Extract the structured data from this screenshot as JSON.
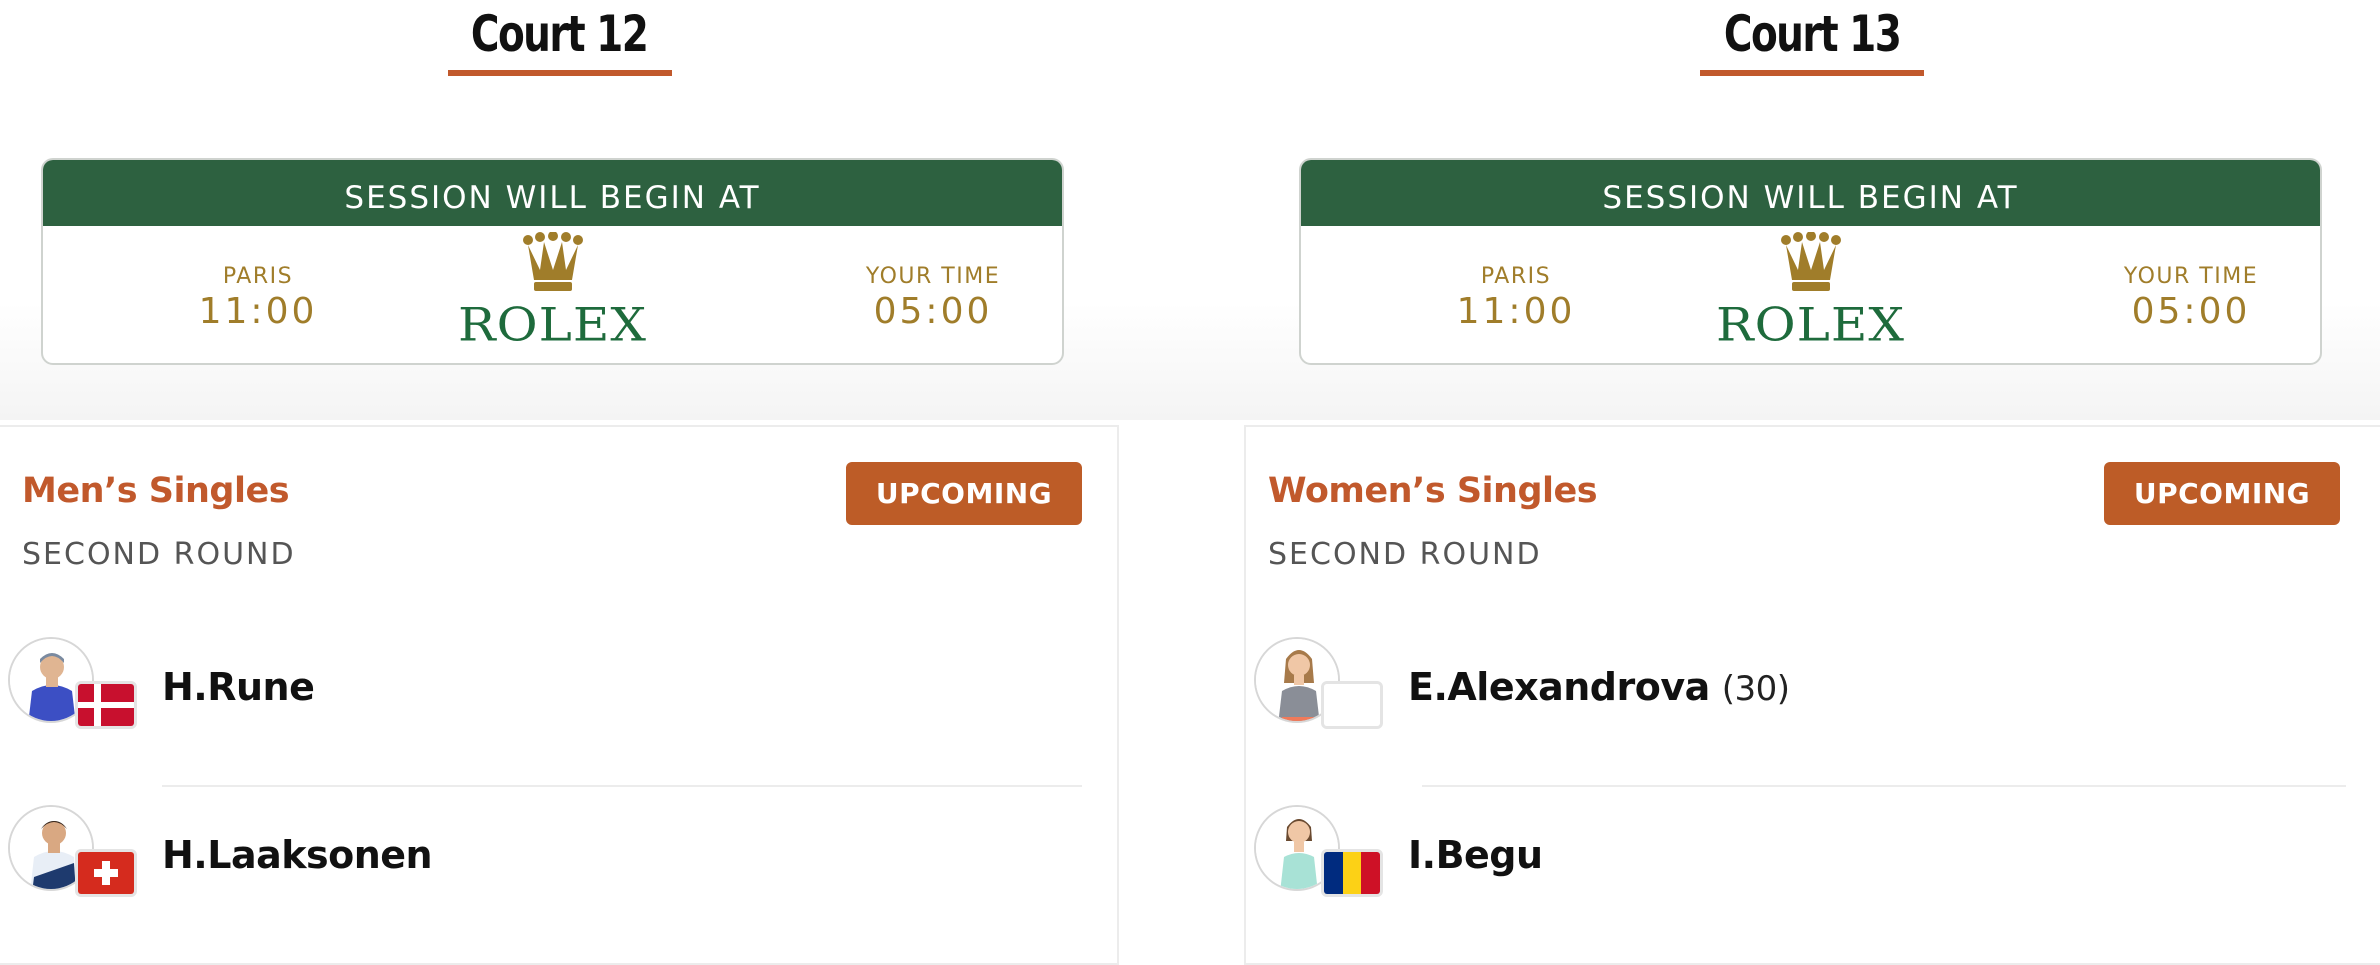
{
  "courts": [
    {
      "title": "Court 12",
      "session": {
        "header": "SESSION WILL BEGIN AT",
        "paris_label": "PARIS",
        "paris_time": "11:00",
        "sponsor": "ROLEX",
        "your_label": "YOUR TIME",
        "your_time": "05:00"
      },
      "match": {
        "event": "Men’s Singles",
        "round": "SECOND ROUND",
        "status": "UPCOMING",
        "players": [
          {
            "name": "H.Rune",
            "seed": "",
            "flag": "denmark-flag-icon"
          },
          {
            "name": "H.Laaksonen",
            "seed": "",
            "flag": "switzerland-flag-icon"
          }
        ]
      }
    },
    {
      "title": "Court 13",
      "session": {
        "header": "SESSION WILL BEGIN AT",
        "paris_label": "PARIS",
        "paris_time": "11:00",
        "sponsor": "ROLEX",
        "your_label": "YOUR TIME",
        "your_time": "05:00"
      },
      "match": {
        "event": "Women’s Singles",
        "round": "SECOND ROUND",
        "status": "UPCOMING",
        "players": [
          {
            "name": "E.Alexandrova",
            "seed": "(30)",
            "flag": "blank-flag-icon"
          },
          {
            "name": "I.Begu",
            "seed": "",
            "flag": "romania-flag-icon"
          }
        ]
      }
    }
  ],
  "colors": {
    "accent": "#c1592c",
    "session_green": "#2d6140",
    "gold": "#a07d2a",
    "rolex_green": "#1e6b3c"
  }
}
